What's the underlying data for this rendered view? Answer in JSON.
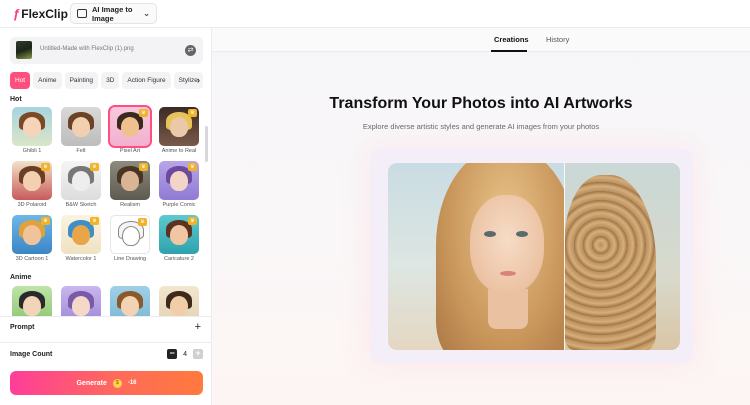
{
  "app": {
    "logo_text": "FlexClip",
    "tool_select": "AI Image to Image"
  },
  "upload": {
    "file_name": "Untitled-Made with FlexClip (1).png"
  },
  "categories": [
    "Hot",
    "Anime",
    "Painting",
    "3D",
    "Action Figure",
    "Stylize"
  ],
  "active_category": "Hot",
  "sections": {
    "hot": "Hot",
    "anime": "Anime"
  },
  "hot_styles": [
    {
      "label": "Ghibli 1",
      "premium": false
    },
    {
      "label": "Felt",
      "premium": false
    },
    {
      "label": "Pixel Art",
      "premium": true
    },
    {
      "label": "Anime to Real",
      "premium": true
    },
    {
      "label": "3D Polaroid",
      "premium": true
    },
    {
      "label": "B&W Sketch",
      "premium": true
    },
    {
      "label": "Realism",
      "premium": true
    },
    {
      "label": "Purple Comic",
      "premium": true
    },
    {
      "label": "3D Cartoon 1",
      "premium": true
    },
    {
      "label": "Watercolor 1",
      "premium": true
    },
    {
      "label": "Line Drawing",
      "premium": true
    },
    {
      "label": "Caricature 2",
      "premium": true
    }
  ],
  "selected_style": "Pixel Art",
  "prompt": {
    "label": "Prompt"
  },
  "image_count": {
    "label": "Image Count",
    "value": "4"
  },
  "generate": {
    "label": "Generate",
    "cost": "-16"
  },
  "tabs": [
    "Creations",
    "History"
  ],
  "active_tab": "Creations",
  "hero": {
    "title": "Transform Your Photos into AI Artworks",
    "subtitle": "Explore diverse artistic styles and generate AI images from your photos"
  },
  "colors": {
    "accent": "#ff4f7d",
    "generate_start": "#ff3d9a",
    "generate_end": "#ff7a3d",
    "premium_badge": "#f0b429"
  }
}
